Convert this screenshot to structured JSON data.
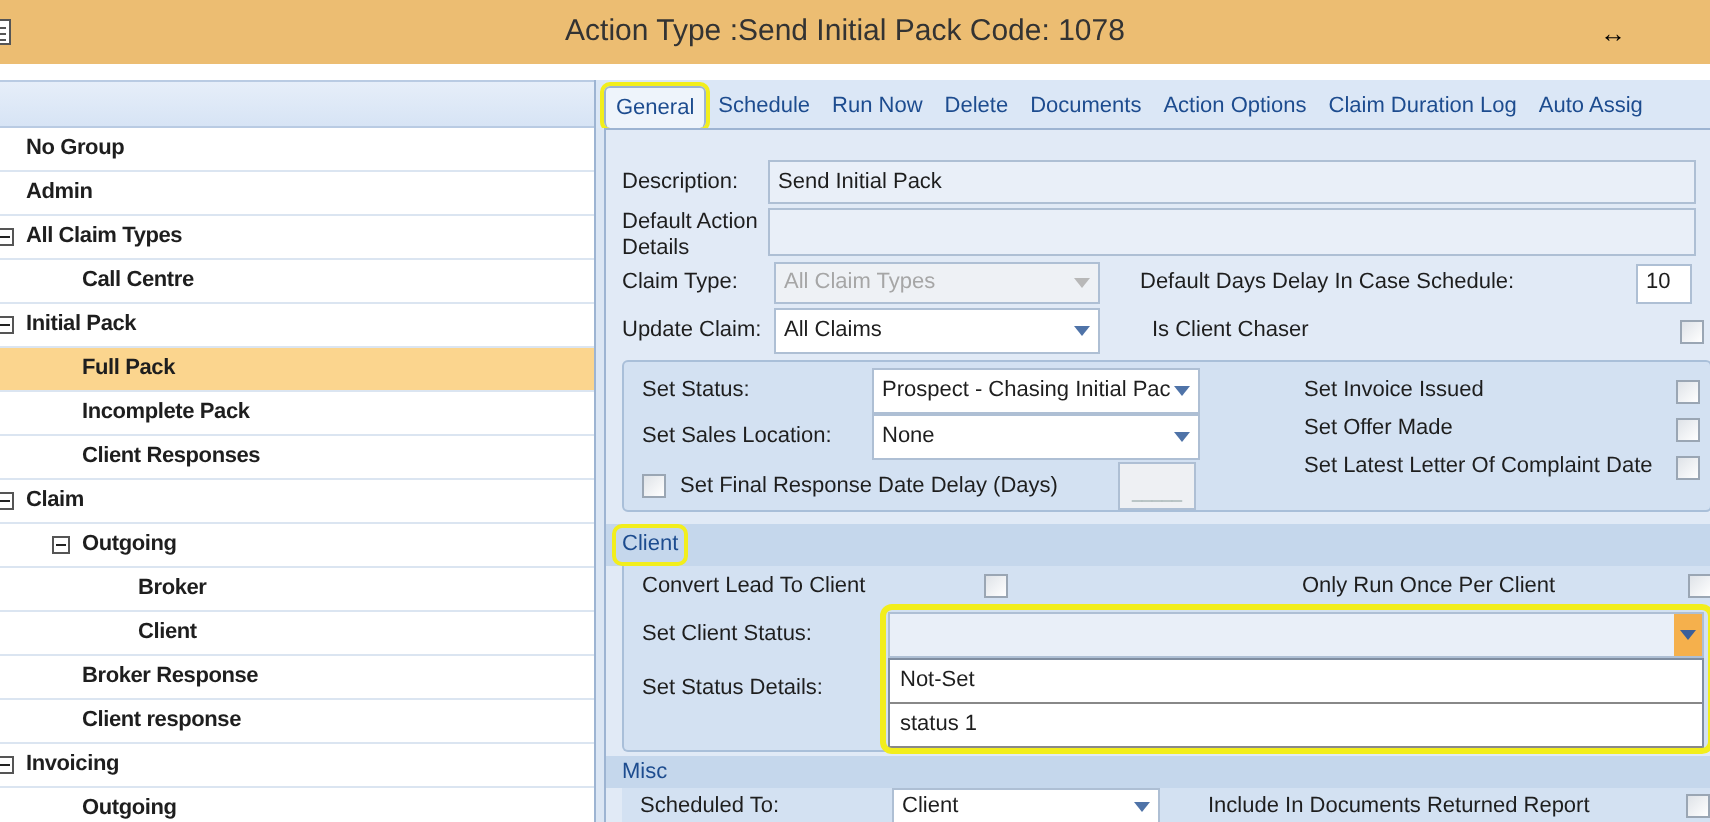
{
  "window": {
    "title": "Action Type :Send Initial Pack Code: 1078",
    "resize_glyph": "↔"
  },
  "tree": [
    {
      "label": "No Group",
      "selected": false
    },
    {
      "label": "Admin",
      "selected": false
    },
    {
      "label": "All Claim Types",
      "selected": false,
      "expanded": true,
      "children": [
        {
          "label": "Call Centre",
          "selected": false
        }
      ]
    },
    {
      "label": "Initial Pack",
      "selected": false,
      "expanded": true,
      "children": [
        {
          "label": "Full Pack",
          "selected": true
        },
        {
          "label": "Incomplete Pack",
          "selected": false
        },
        {
          "label": "Client Responses",
          "selected": false
        }
      ]
    },
    {
      "label": "Claim",
      "selected": false,
      "expanded": true,
      "children": [
        {
          "label": "Outgoing",
          "selected": false,
          "expanded": true,
          "children": [
            {
              "label": "Broker",
              "selected": false
            },
            {
              "label": "Client",
              "selected": false
            }
          ]
        },
        {
          "label": "Broker Response",
          "selected": false
        },
        {
          "label": "Client response",
          "selected": false
        }
      ]
    },
    {
      "label": "Invoicing",
      "selected": false,
      "expanded": true,
      "children": [
        {
          "label": "Outgoing",
          "selected": false
        }
      ]
    }
  ],
  "tabs": [
    {
      "label": "General",
      "selected": true,
      "highlighted": true
    },
    {
      "label": "Schedule",
      "selected": false,
      "highlighted": false
    },
    {
      "label": "Run Now",
      "selected": false,
      "highlighted": false
    },
    {
      "label": "Delete",
      "selected": false,
      "highlighted": false
    },
    {
      "label": "Documents",
      "selected": false,
      "highlighted": false
    },
    {
      "label": "Action Options",
      "selected": false,
      "highlighted": false
    },
    {
      "label": "Claim Duration Log",
      "selected": false,
      "highlighted": false
    },
    {
      "label": "Auto Assig",
      "selected": false,
      "highlighted": false
    }
  ],
  "description": {
    "label": "Description:",
    "value": "Send Initial Pack"
  },
  "default_action_details": {
    "label": "Default Action Details"
  },
  "claim_type": {
    "label": "Claim Type:",
    "value": "All Claim Types",
    "disabled": true
  },
  "default_days_delay": {
    "label": "Default Days Delay In Case Schedule:",
    "value": "10"
  },
  "update_claim": {
    "label": "Update Claim:",
    "value": "All Claims"
  },
  "is_client_chaser": {
    "label": "Is Client Chaser",
    "checked": false
  },
  "status_group": {
    "set_status": {
      "label": "Set Status:",
      "value": "Prospect - Chasing Initial Pac"
    },
    "set_sales_location": {
      "label": "Set Sales Location:",
      "value": "None"
    },
    "final_response_delay": {
      "label": "Set Final Response Date Delay (Days)",
      "checked": false,
      "placeholder": "_____"
    },
    "flags": [
      {
        "label": "Set Invoice Issued",
        "checked": false
      },
      {
        "label": "Set Offer Made",
        "checked": false
      },
      {
        "label": "Set Latest Letter Of Complaint Date",
        "checked": false
      }
    ]
  },
  "client": {
    "title": "Client",
    "highlighted": true,
    "convert_lead": {
      "label": "Convert Lead To Client",
      "checked": false
    },
    "only_run_once": {
      "label": "Only Run Once Per Client",
      "checked": false
    },
    "set_client_status": {
      "label": "Set Client Status:",
      "open": true,
      "highlighted": true,
      "options": [
        {
          "label": "Not-Set",
          "selected": false
        },
        {
          "label": "status 1",
          "selected": false
        }
      ]
    },
    "set_status_details": {
      "label": "Set Status Details:"
    }
  },
  "misc": {
    "title": "Misc",
    "scheduled_to": {
      "label": "Scheduled To:",
      "value": "Client"
    },
    "include_in_documents_returned": {
      "label": "Include In Documents Returned Report",
      "checked": false
    }
  }
}
